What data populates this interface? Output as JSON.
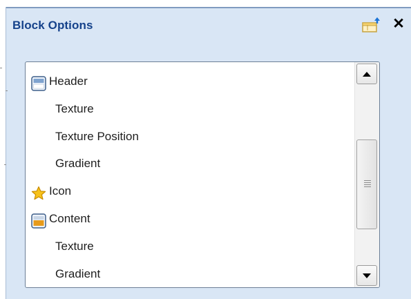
{
  "panel": {
    "title": "Block Options",
    "icons": {
      "pin": "panel-options-icon",
      "close": "close-icon"
    },
    "close_glyph": "✕"
  },
  "list": {
    "items": [
      {
        "label": "Header",
        "icon": "header-block-icon",
        "indent": false
      },
      {
        "label": "Texture",
        "icon": null,
        "indent": true
      },
      {
        "label": "Texture Position",
        "icon": null,
        "indent": true
      },
      {
        "label": "Gradient",
        "icon": null,
        "indent": true
      },
      {
        "label": "Icon",
        "icon": "star-icon",
        "indent": false
      },
      {
        "label": "Content",
        "icon": "content-block-icon",
        "indent": false
      },
      {
        "label": "Texture",
        "icon": null,
        "indent": true
      },
      {
        "label": "Gradient",
        "icon": null,
        "indent": true
      }
    ]
  },
  "colors": {
    "panel_bg": "#d9e6f5",
    "title": "#15428b",
    "header_icon": "#7fa3cf",
    "content_icon": "#e79b1c",
    "star": "#f7c21b"
  }
}
